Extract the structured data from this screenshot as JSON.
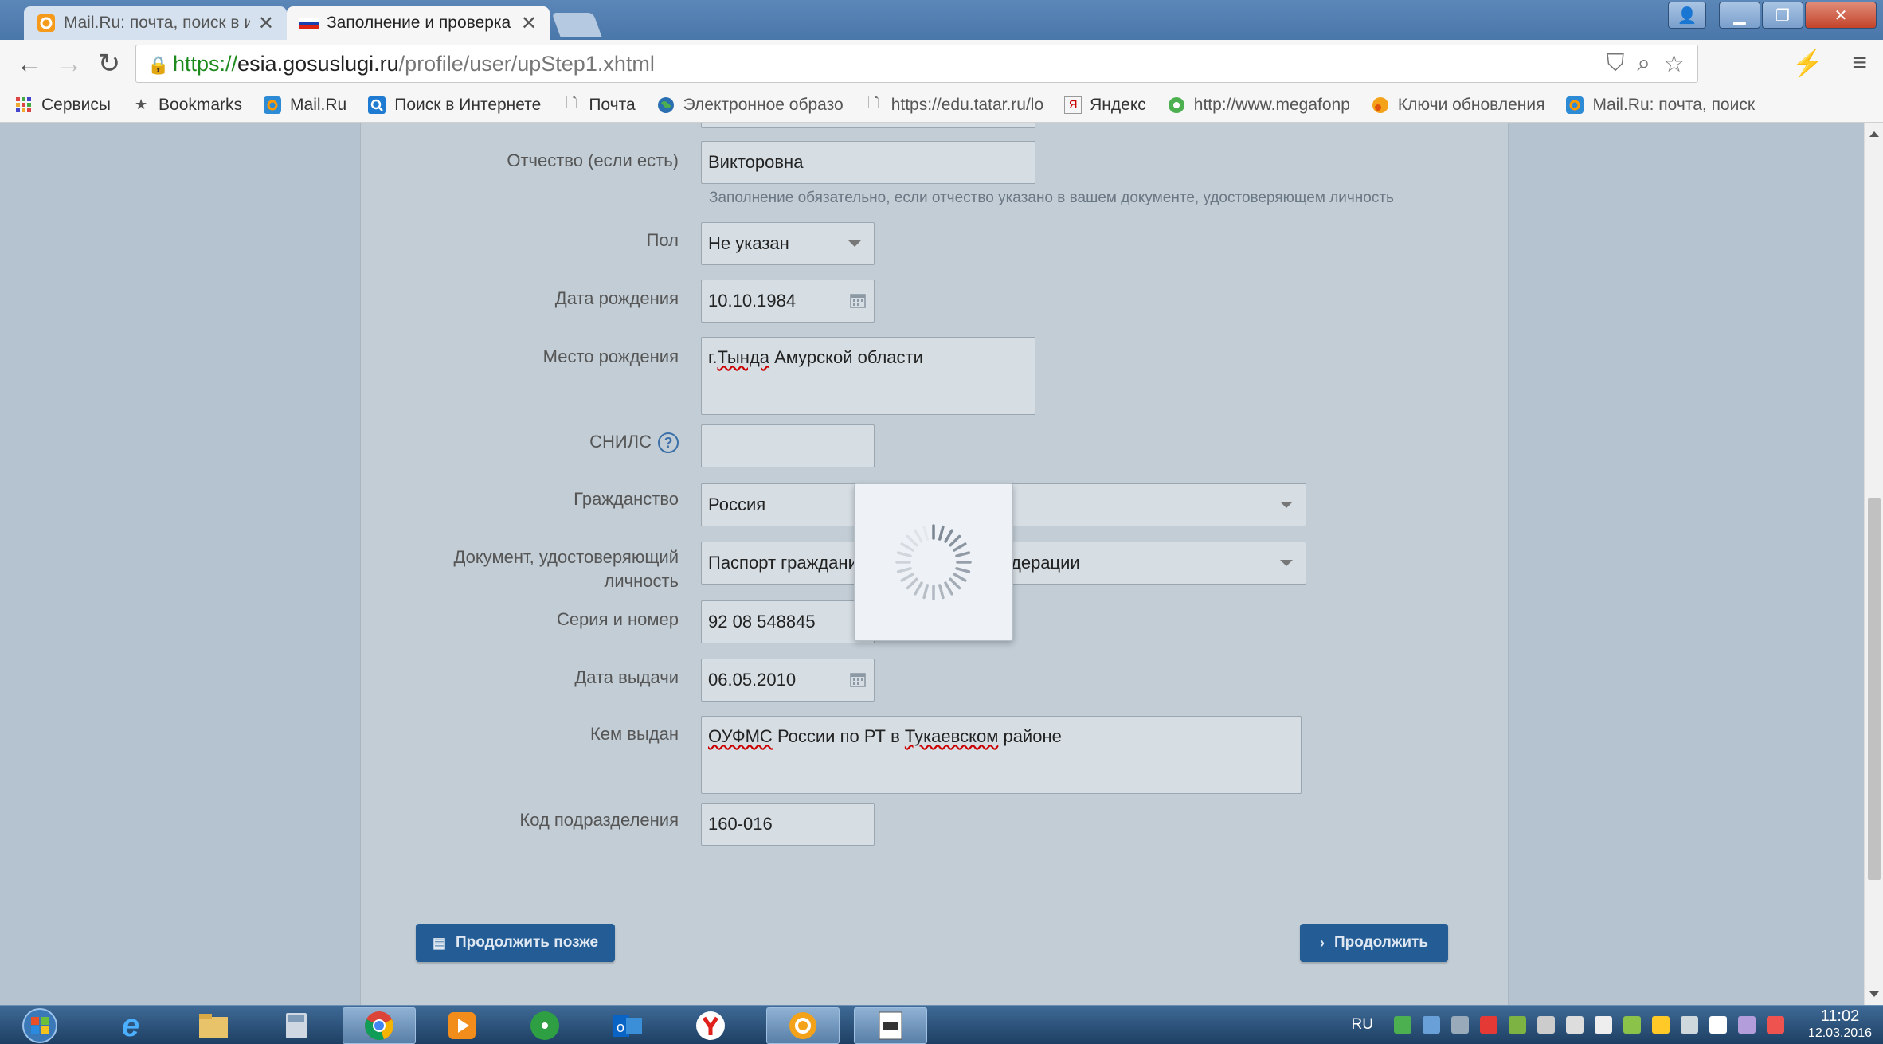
{
  "browser": {
    "tabs": [
      {
        "title": "Mail.Ru: почта, поиск в и",
        "active": false
      },
      {
        "title": "Заполнение и проверка",
        "active": true
      }
    ],
    "url": {
      "scheme": "https://",
      "host": "esia.gosuslugi.ru",
      "path": "/profile/user/upStep1.xhtml"
    }
  },
  "bookmarks": [
    {
      "label": "Сервисы",
      "icon": "apps-grid-icon"
    },
    {
      "label": "Bookmarks",
      "icon": "star-icon"
    },
    {
      "label": "Mail.Ru",
      "icon": "mailru-icon"
    },
    {
      "label": "Поиск в Интернете",
      "icon": "search-icon"
    },
    {
      "label": "Почта",
      "icon": "page-icon"
    },
    {
      "label": "Электронное образо",
      "icon": "globe-icon"
    },
    {
      "label": "https://edu.tatar.ru/lo",
      "icon": "page-icon"
    },
    {
      "label": "Яндекс",
      "icon": "yandex-icon"
    },
    {
      "label": "http://www.megafonp",
      "icon": "megafon-icon"
    },
    {
      "label": "Ключи обновления",
      "icon": "key-icon"
    },
    {
      "label": "Mail.Ru: почта, поиск",
      "icon": "mailru-icon"
    }
  ],
  "form": {
    "patronymic": {
      "label": "Отчество (если есть)",
      "value": "Викторовна",
      "hint": "Заполнение обязательно, если отчество указано в вашем документе, удостоверяющем личность"
    },
    "gender": {
      "label": "Пол",
      "value": "Не указан"
    },
    "birth_date": {
      "label": "Дата рождения",
      "value": "10.10.1984"
    },
    "birth_place": {
      "label": "Место рождения",
      "value_prefix": "г.",
      "value_underlined": "Тында",
      "value_rest": " Амурской области"
    },
    "snils": {
      "label": "СНИЛС",
      "help": "?",
      "value": ""
    },
    "citizenship": {
      "label": "Гражданство",
      "value": "Россия"
    },
    "document": {
      "label_line1": "Документ, удостоверяющий",
      "label_line2": "личность",
      "value_left": "Паспорт граждани",
      "value_right": "дерации"
    },
    "series_number": {
      "label": "Серия и номер",
      "value": "92 08 548845"
    },
    "issue_date": {
      "label": "Дата выдачи",
      "value": "06.05.2010"
    },
    "issued_by": {
      "label": "Кем выдан",
      "value_word1": "ОУФМС",
      "value_mid": " России по РТ в ",
      "value_word2": "Тукаевском",
      "value_rest": " районе"
    },
    "division_code": {
      "label": "Код подразделения",
      "value": "160-016"
    }
  },
  "buttons": {
    "later": "Продолжить позже",
    "continue": "Продолжить"
  },
  "taskbar": {
    "lang": "RU",
    "time": "11:02",
    "date": "12.03.2016"
  },
  "colors": {
    "primary_button": "#245d95",
    "page_bg": "#b4c3cf"
  }
}
